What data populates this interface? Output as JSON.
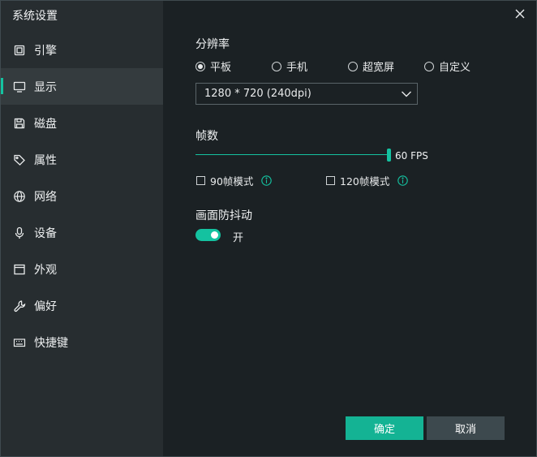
{
  "window": {
    "title": "系统设置"
  },
  "sidebar": {
    "items": [
      {
        "label": "引擎",
        "icon": "engine-chip-icon"
      },
      {
        "label": "显示",
        "icon": "monitor-icon",
        "active": true
      },
      {
        "label": "磁盘",
        "icon": "save-disk-icon"
      },
      {
        "label": "属性",
        "icon": "tag-icon"
      },
      {
        "label": "网络",
        "icon": "globe-icon"
      },
      {
        "label": "设备",
        "icon": "microphone-icon"
      },
      {
        "label": "外观",
        "icon": "window-icon"
      },
      {
        "label": "偏好",
        "icon": "wrench-icon"
      },
      {
        "label": "快捷键",
        "icon": "keyboard-icon"
      }
    ]
  },
  "resolution": {
    "title": "分辨率",
    "options": [
      {
        "label": "平板",
        "checked": true
      },
      {
        "label": "手机",
        "checked": false
      },
      {
        "label": "超宽屏",
        "checked": false
      },
      {
        "label": "自定义",
        "checked": false
      }
    ],
    "selected": "1280 * 720 (240dpi)"
  },
  "fps": {
    "title": "帧数",
    "value_label": "60 FPS",
    "fraction": 1.0,
    "mode90_label": "90帧模式",
    "mode120_label": "120帧模式",
    "mode90_checked": false,
    "mode120_checked": false
  },
  "stabilization": {
    "title": "画面防抖动",
    "state_label": "开",
    "on": true
  },
  "footer": {
    "confirm_label": "确定",
    "cancel_label": "取消"
  },
  "colors": {
    "accent": "#14c2a0",
    "sidebar_bg": "#272d30",
    "content_bg": "#1b2124"
  }
}
